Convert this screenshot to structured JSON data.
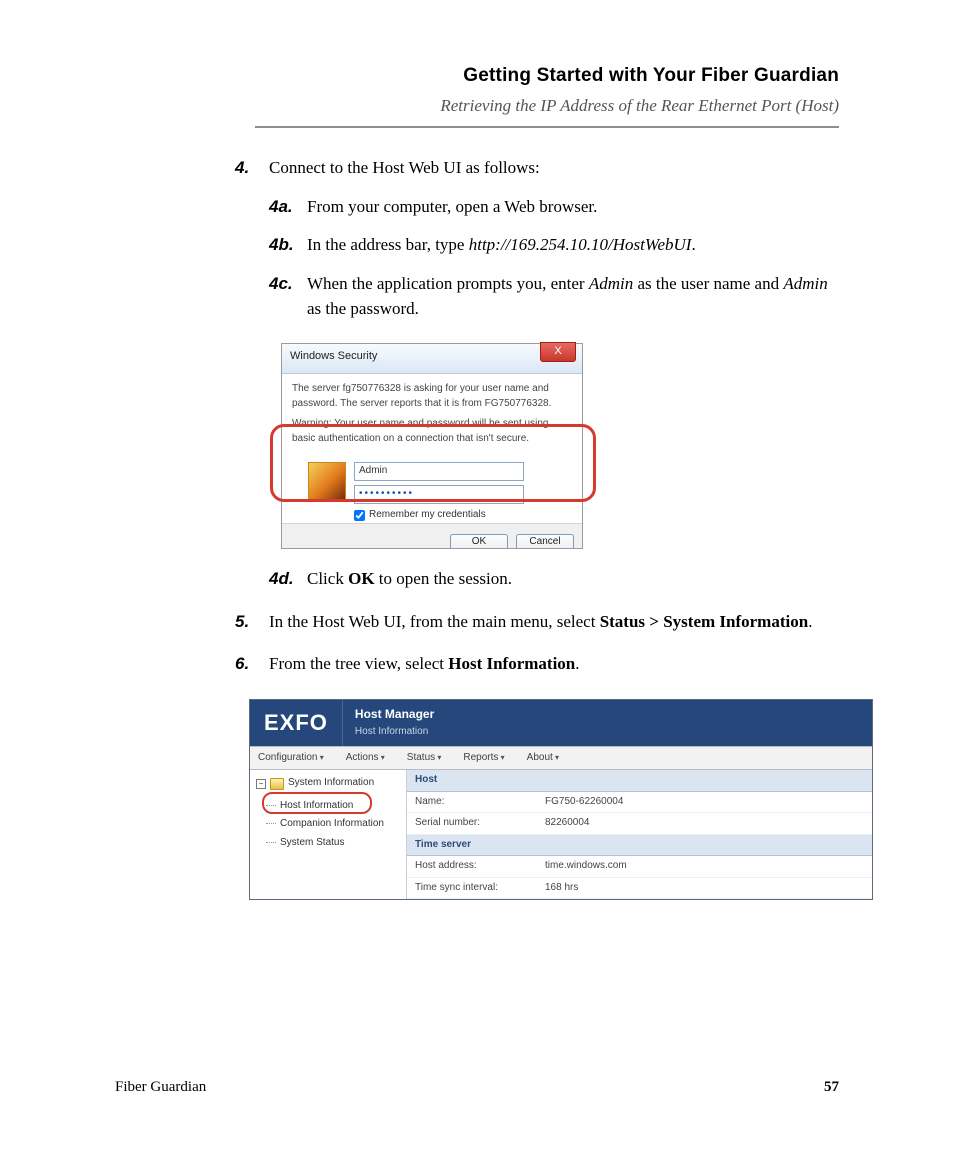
{
  "header": {
    "title": "Getting Started with Your Fiber Guardian",
    "subtitle": "Retrieving the IP Address of the Rear Ethernet Port (Host)"
  },
  "steps": {
    "s4": {
      "num": "4.",
      "text": "Connect to the Host Web UI as follows:",
      "a": {
        "num": "4a.",
        "text": "From your computer, open a Web browser."
      },
      "b": {
        "num": "4b.",
        "prefix": "In the address bar, type ",
        "ital": "http://169.254.10.10/HostWebUI",
        "suffix": "."
      },
      "c": {
        "num": "4c.",
        "p1": "When the application prompts you, enter ",
        "i1": "Admin",
        "p2": " as the user name and ",
        "i2": "Admin",
        "p3": " as the password."
      },
      "d": {
        "num": "4d.",
        "prefix": "Click ",
        "bold": "OK",
        "suffix": " to open the session."
      }
    },
    "s5": {
      "num": "5.",
      "prefix": "In the Host Web UI, from the main menu, select ",
      "bold": "Status > System Information",
      "suffix": "."
    },
    "s6": {
      "num": "6.",
      "prefix": "From the tree view, select ",
      "bold": "Host Information",
      "suffix": "."
    }
  },
  "dialog": {
    "title": "Windows Security",
    "close": "X",
    "msg": "The server fg750776328 is asking for your user name and password. The server reports that it is from FG750776328.",
    "warn": "Warning: Your user name and password will be sent using basic authentication on a connection that isn't secure.",
    "user_value": "Admin",
    "pw_value": "••••••••••",
    "remember": "Remember my credentials",
    "ok": "OK",
    "cancel": "Cancel"
  },
  "hostmgr": {
    "logo": "EXFO",
    "title": "Host Manager",
    "subtitle": "Host Information",
    "menu": [
      "Configuration",
      "Actions",
      "Status",
      "Reports",
      "About"
    ],
    "tree": {
      "root": "System Information",
      "items": [
        "Host Information",
        "Companion Information",
        "System Status"
      ]
    },
    "sections": [
      {
        "header": "Host",
        "rows": [
          {
            "k": "Name:",
            "v": "FG750-62260004"
          },
          {
            "k": "Serial number:",
            "v": "82260004"
          }
        ]
      },
      {
        "header": "Time server",
        "rows": [
          {
            "k": "Host address:",
            "v": "time.windows.com"
          },
          {
            "k": "Time sync interval:",
            "v": "168 hrs"
          }
        ]
      }
    ]
  },
  "footer": {
    "product": "Fiber Guardian",
    "page": "57"
  }
}
